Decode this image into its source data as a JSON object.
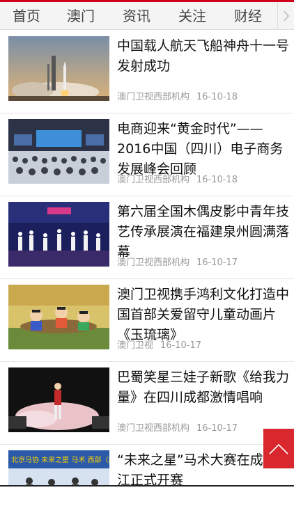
{
  "tabs": [
    "首页",
    "澳门",
    "资讯",
    "关注",
    "财经"
  ],
  "articles": [
    {
      "title": "中国载人航天飞船神舟十一号发射成功",
      "source": "澳门卫视西部机构",
      "date": "16-10-18"
    },
    {
      "title": "电商迎来“黄金时代”——2016中国（四川）电子商务发展峰会回顾",
      "source": "澳门卫视西部机构",
      "date": "16-10-18"
    },
    {
      "title": "第六届全国木偶皮影中青年技艺传承展演在福建泉州圆满落幕",
      "source": "澳门卫视西部机构",
      "date": "16-10-17"
    },
    {
      "title": "澳门卫视携手鸿利文化打造中国首部关爱留守儿童动画片《玉琉璃》",
      "source": "澳门卫视",
      "date": "16-10-17"
    },
    {
      "title": "巴蜀笑星三娃子新歌《给我力量》在四川成都激情唱响",
      "source": "澳门卫视西部机构",
      "date": "16-10-17"
    },
    {
      "title": "“未来之星”马术大赛在成都锦江正式开赛",
      "thumb_text": "北京马协 未来之星 马术 西部（成都站）"
    }
  ],
  "colors": {
    "accent": "#d0021b",
    "to_top_bg": "#d9272e"
  },
  "icons": {
    "more": "chevron-right-icon",
    "to_top": "arrow-up-icon"
  }
}
